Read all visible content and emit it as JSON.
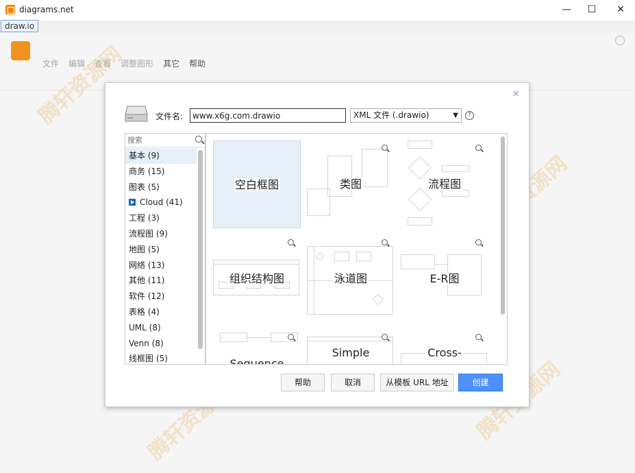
{
  "window": {
    "title": "diagrams.net",
    "minimize_glyph": "—",
    "maximize_glyph": "☐",
    "close_glyph": "✕",
    "tooltip": "draw.io"
  },
  "menubar": {
    "items": [
      "文件",
      "编辑",
      "查看",
      "调整图形",
      "其它",
      "帮助"
    ]
  },
  "dialog": {
    "close_glyph": "✕",
    "filename_label": "文件名:",
    "filename_value": "www.x6g.com.drawio",
    "format_value": "XML 文件 (.drawio)",
    "help_glyph": "?",
    "search_placeholder": "搜索",
    "categories": [
      {
        "label": "基本 (9)",
        "selected": true
      },
      {
        "label": "商务 (15)"
      },
      {
        "label": "图表 (5)"
      },
      {
        "label": "Cloud (41)",
        "icon": "cloud-expand-icon"
      },
      {
        "label": "工程 (3)"
      },
      {
        "label": "流程图 (9)"
      },
      {
        "label": "地图 (5)"
      },
      {
        "label": "网络 (13)"
      },
      {
        "label": "其他 (11)"
      },
      {
        "label": "软件 (12)"
      },
      {
        "label": "表格 (4)"
      },
      {
        "label": "UML (8)"
      },
      {
        "label": "Venn (8)"
      },
      {
        "label": "线框图 (5)"
      }
    ],
    "templates": [
      {
        "label": "空白框图",
        "selected": true
      },
      {
        "label": "类图"
      },
      {
        "label": "流程图"
      },
      {
        "label": "组织结构图"
      },
      {
        "label": "泳道图"
      },
      {
        "label": "E-R图"
      },
      {
        "label": "Sequence"
      },
      {
        "label": "Simple"
      },
      {
        "label": "Cross-"
      }
    ],
    "buttons": {
      "help": "帮助",
      "cancel": "取消",
      "from_url": "从模板 URL 地址",
      "create": "创建"
    }
  },
  "colors": {
    "accent": "#4d90fe",
    "brand": "#f08705",
    "selected_bg": "#e6eef8"
  }
}
